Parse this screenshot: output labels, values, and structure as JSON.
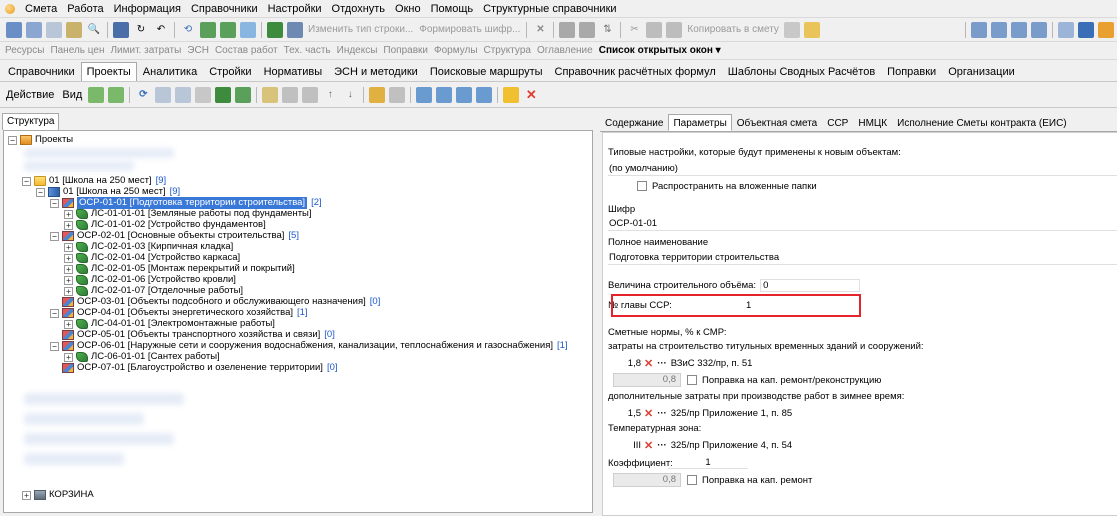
{
  "menu": [
    "Смета",
    "Работа",
    "Информация",
    "Справочники",
    "Настройки",
    "Отдохнуть",
    "Окно",
    "Помощь",
    "Структурные справочники"
  ],
  "toolbar1": {
    "change_row_type": "Изменить тип строки...",
    "form_cipher": "Формировать шифр...",
    "copy_to_estimate": "Копировать в смету"
  },
  "toolbar2": {
    "links": [
      "Ресурсы",
      "Панель цен",
      "Лимит. затраты",
      "ЭСН",
      "Состав работ",
      "Тех. часть",
      "Индексы",
      "Поправки",
      "Формулы",
      "Структура",
      "Оглавление"
    ],
    "open_windows": "Список открытых окон ▾"
  },
  "tabs": [
    "Справочники",
    "Проекты",
    "Аналитика",
    "Стройки",
    "Нормативы",
    "ЭСН и методики",
    "Поисковые маршруты",
    "Справочник расчётных формул",
    "Шаблоны Сводных Расчётов",
    "Поправки",
    "Организации"
  ],
  "active_tab": "Проекты",
  "toolbar3": {
    "action": "Действие",
    "view": "Вид"
  },
  "left": {
    "structure_tab": "Структура",
    "tree": [
      {
        "label": "Проекты",
        "count": ""
      },
      {
        "label": "01 [Школа на 250 мест]",
        "count": "[9]"
      },
      {
        "label": "01 [Школа на 250 мест]",
        "count": "[9]"
      },
      {
        "label": "ОСР-01-01 [Подготовка территории строительства]",
        "count": "[2]"
      },
      {
        "label": "ЛС-01-01-01 [Земляные работы под фундаменты]",
        "count": ""
      },
      {
        "label": "ЛС-01-01-02 [Устройство фундаментов]",
        "count": ""
      },
      {
        "label": "ОСР-02-01 [Основные объекты строительства]",
        "count": "[5]"
      },
      {
        "label": "ЛС-02-01-03 [Кирпичная кладка]",
        "count": ""
      },
      {
        "label": "ЛС-02-01-04 [Устройство каркаса]",
        "count": ""
      },
      {
        "label": "ЛС-02-01-05 [Монтаж перекрытий и покрытий]",
        "count": ""
      },
      {
        "label": "ЛС-02-01-06 [Устройство кровли]",
        "count": ""
      },
      {
        "label": "ЛС-02-01-07 [Отделочные работы]",
        "count": ""
      },
      {
        "label": "ОСР-03-01 [Объекты подсобного и обслуживающего назначения]",
        "count": "[0]"
      },
      {
        "label": "ОСР-04-01 [Объекты энергетического хозяйства]",
        "count": "[1]"
      },
      {
        "label": "ЛС-04-01-01 [Электромонтажные работы]",
        "count": ""
      },
      {
        "label": "ОСР-05-01 [Объекты транспортного хозяйства и связи]",
        "count": "[0]"
      },
      {
        "label": "ОСР-06-01 [Наружные сети и сооружения водоснабжения, канализации, теплоснабжения и газоснабжения]",
        "count": "[1]"
      },
      {
        "label": "ЛС-06-01-01 [Сантех работы]",
        "count": ""
      },
      {
        "label": "ОСР-07-01 [Благоустройство и озеленение территории]",
        "count": "[0]"
      },
      {
        "label": "КОРЗИНА",
        "count": ""
      }
    ]
  },
  "right": {
    "tabs": [
      "Содержание",
      "Параметры",
      "Объектная смета",
      "ССР",
      "НМЦК",
      "Исполнение Сметы контракта (ЕИС)"
    ],
    "typical_settings_label": "Типовые настройки, которые будут применены к новым объектам:",
    "typical_settings_value": "(по умолчанию)",
    "propagate_label": "Распространить на вложенные папки",
    "cipher_label": "Шифр",
    "cipher_value": "ОСР-01-01",
    "full_name_label": "Полное наименование",
    "full_name_value": "Подготовка территории строительства",
    "volume_label": "Величина строительного объёма:",
    "volume_value": "0",
    "chapter_label": "№ главы ССР:",
    "chapter_value": "1",
    "norms_label": "Сметные нормы, % к СМР:",
    "temp_buildings_label": "затраты на строительство титульных временных зданий и сооружений:",
    "temp_value": "1,8",
    "temp_ref": "ВЗиС 332/пр, п. 51",
    "repair1_value": "0,8",
    "repair1_label": "Поправка на кап. ремонт/реконструкцию",
    "winter_label": "дополнительные затраты при производстве работ в зимнее время:",
    "winter_value": "1,5",
    "winter_ref": "325/пр Приложение 1, п. 85",
    "temp_zone_label": "Температурная зона:",
    "temp_zone_value": "III",
    "temp_zone_ref": "325/пр Приложение 4, п. 54",
    "coef_label": "Коэффициент:",
    "coef_value": "1",
    "repair2_value": "0,8",
    "repair2_label": "Поправка на кап. ремонт"
  }
}
